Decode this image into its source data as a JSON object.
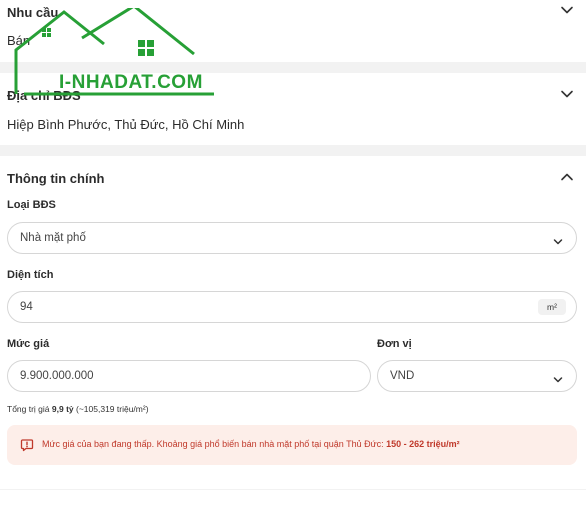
{
  "sections": {
    "need": {
      "title": "Nhu cầu",
      "value": "Bán"
    },
    "address": {
      "title": "Địa chỉ BĐS",
      "value": "Hiệp Bình Phước, Thủ Đức, Hồ Chí Minh"
    },
    "main_info": {
      "title": "Thông tin chính"
    }
  },
  "form": {
    "type_label": "Loại BĐS",
    "type_value": "Nhà mặt phố",
    "area_label": "Diện tích",
    "area_value": "94",
    "area_unit": "m²",
    "price_label": "Mức giá",
    "price_value": "9.900.000.000",
    "currency_label": "Đơn vị",
    "currency_value": "VND",
    "total_prefix": "Tổng trị giá ",
    "total_value": "9,9 tỷ",
    "total_suffix": " (~105,319 triệu/m²)"
  },
  "warning": {
    "text": "Mức giá của bạn đang thấp. Khoảng giá phổ biến bán nhà mặt phố tại quận Thủ Đức: ",
    "range": "150 - 262 triệu/m²",
    "color": "#c0392b",
    "background": "#fdeee9"
  },
  "watermark": {
    "text": "I-NHADAT.COM",
    "color": "#27a036"
  }
}
